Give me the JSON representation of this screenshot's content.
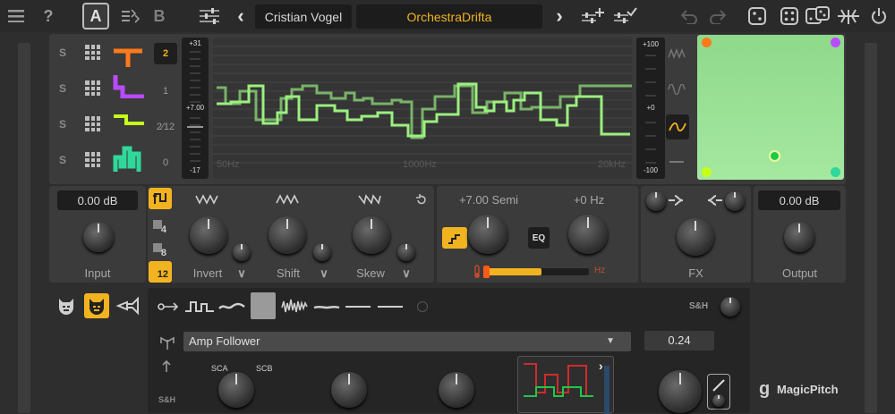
{
  "topbar": {
    "help_glyph": "?",
    "slot_a": "A",
    "slot_b": "B",
    "prev_glyph": "‹",
    "next_glyph": "›",
    "author": "Cristian Vogel",
    "preset_name": "OrchestraDrifta",
    "accent_color": "#f2b320"
  },
  "lanes": [
    {
      "label": "S",
      "ratio": "2",
      "color": "#ff7a1a"
    },
    {
      "label": "S",
      "ratio": "1",
      "color": "#b84bff"
    },
    {
      "label": "S",
      "ratio": "2⁄12",
      "color": "#c6ff1a"
    },
    {
      "label": "S",
      "ratio": "0",
      "color": "#2fd79a"
    }
  ],
  "meter_left": {
    "top": "+31",
    "mid": "+7.00",
    "bottom": "-17"
  },
  "meter_right": {
    "top": "+100",
    "mid": "+0",
    "bottom": "-100"
  },
  "graph": {
    "freq_low": "50Hz",
    "freq_mid": "1000Hz",
    "freq_high": "20kHz"
  },
  "input": {
    "value": "0.00 dB",
    "label": "Input"
  },
  "output": {
    "value": "0.00 dB",
    "label": "Output"
  },
  "steps": [
    "4",
    "8",
    "12"
  ],
  "mod_knobs": [
    {
      "label": "Invert",
      "chevron": "∨"
    },
    {
      "label": "Shift",
      "chevron": "∨"
    },
    {
      "label": "Skew",
      "chevron": "∨"
    }
  ],
  "pitch": {
    "semi": "+7.00 Semi",
    "hz": "+0 Hz",
    "eq": "EQ",
    "range_end": "Hz",
    "slider_fill_pct": 0.55
  },
  "fx": {
    "label": "FX"
  },
  "sh": {
    "label": "S&H"
  },
  "modulator": {
    "source": "Amp Follower",
    "value": "0.24",
    "sca": "SCA",
    "scb": "SCB",
    "side_label": "S&H"
  },
  "brand": {
    "logo": "g",
    "name": "MagicPitch"
  }
}
